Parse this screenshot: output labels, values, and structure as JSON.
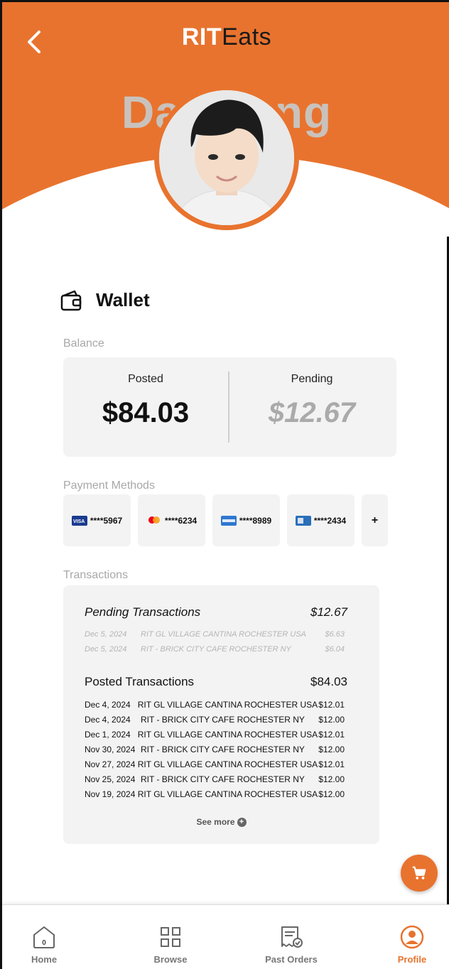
{
  "header": {
    "title_part1": "RIT",
    "title_part2": "Eats",
    "user_name": "Dae Jung"
  },
  "wallet": {
    "title": "Wallet",
    "balance_label": "Balance",
    "posted_label": "Posted",
    "posted_amount": "$84.03",
    "pending_label": "Pending",
    "pending_amount": "$12.67"
  },
  "payment_methods": {
    "label": "Payment Methods",
    "cards": [
      {
        "brand": "visa",
        "masked": "****5967"
      },
      {
        "brand": "mastercard",
        "masked": "****6234"
      },
      {
        "brand": "amex",
        "masked": "****8989"
      },
      {
        "brand": "discover",
        "masked": "****2434"
      }
    ],
    "add_label": "+"
  },
  "transactions": {
    "label": "Transactions",
    "pending_title": "Pending Transactions",
    "pending_total": "$12.67",
    "pending": [
      {
        "date": "Dec 5, 2024",
        "merchant": "RIT GL VILLAGE CANTINA ROCHESTER USA",
        "amount": "$6.63"
      },
      {
        "date": "Dec 5, 2024",
        "merchant": "RIT - BRICK CITY CAFE ROCHESTER NY",
        "amount": "$6.04"
      }
    ],
    "posted_title": "Posted Transactions",
    "posted_total": "$84.03",
    "posted": [
      {
        "date": "Dec 4, 2024",
        "merchant": "RIT GL VILLAGE CANTINA ROCHESTER USA",
        "amount": "$12.01"
      },
      {
        "date": "Dec 4, 2024",
        "merchant": "RIT - BRICK CITY CAFE ROCHESTER NY",
        "amount": "$12.00"
      },
      {
        "date": "Dec 1, 2024",
        "merchant": "RIT GL VILLAGE CANTINA ROCHESTER USA",
        "amount": "$12.01"
      },
      {
        "date": "Nov 30, 2024",
        "merchant": "RIT - BRICK CITY CAFE ROCHESTER NY",
        "amount": "$12.00"
      },
      {
        "date": "Nov 27, 2024",
        "merchant": "RIT GL VILLAGE CANTINA ROCHESTER USA",
        "amount": "$12.01"
      },
      {
        "date": "Nov 25, 2024",
        "merchant": "RIT - BRICK CITY CAFE ROCHESTER NY",
        "amount": "$12.00"
      },
      {
        "date": "Nov 19, 2024",
        "merchant": "RIT GL VILLAGE CANTINA ROCHESTER USA",
        "amount": "$12.00"
      }
    ],
    "see_more_label": "See more"
  },
  "nav": {
    "home_label": "Home",
    "home_badge": "0",
    "browse_label": "Browse",
    "past_orders_label": "Past Orders",
    "profile_label": "Profile",
    "active": "profile"
  },
  "colors": {
    "accent": "#E8732E",
    "card_bg": "#F3F3F3",
    "muted_text": "#A8A8A8"
  },
  "icons": [
    "back-arrow-icon",
    "wallet-icon",
    "cart-icon",
    "home-icon",
    "browse-grid-icon",
    "receipt-icon",
    "profile-icon",
    "plus-circle-icon"
  ]
}
